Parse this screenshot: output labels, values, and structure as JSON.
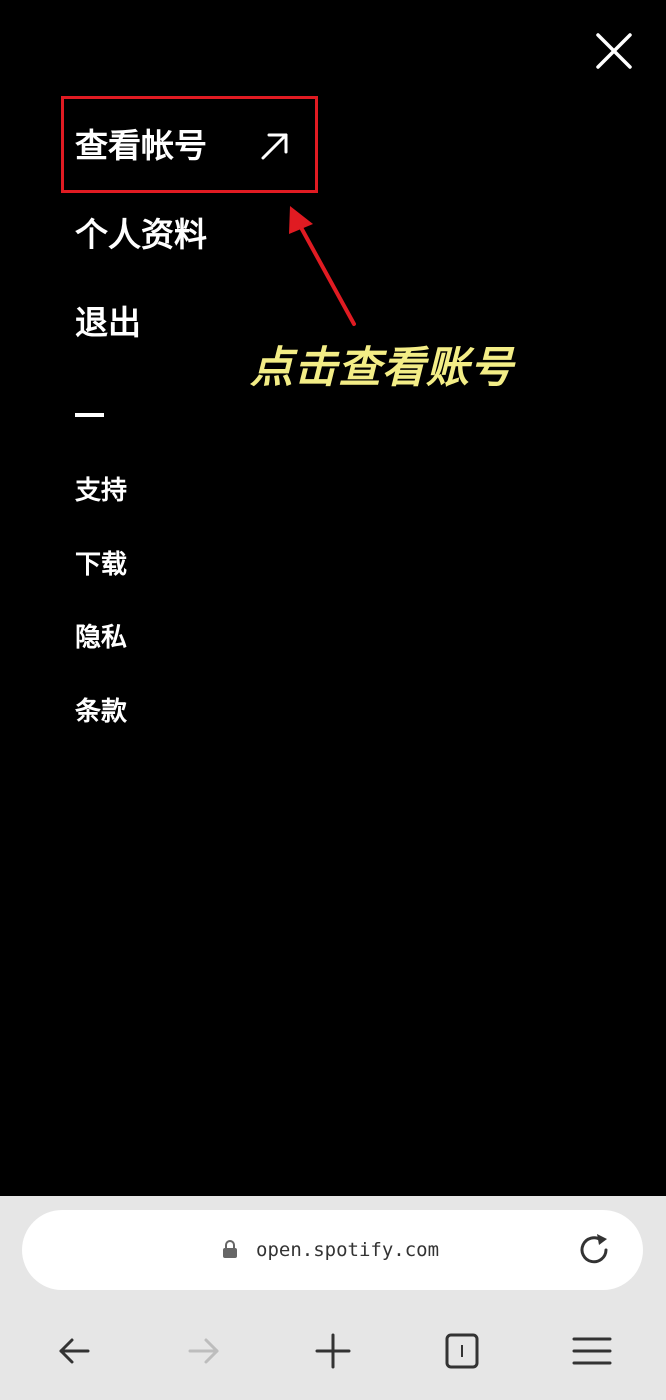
{
  "menu": {
    "view_account": "查看帐号",
    "profile": "个人资料",
    "logout": "退出",
    "support": "支持",
    "download": "下载",
    "privacy": "隐私",
    "terms": "条款"
  },
  "annotation": {
    "text": "点击查看账号",
    "color": "#f3ed86",
    "box_color": "#e01b22"
  },
  "browser": {
    "url": "open.spotify.com",
    "icons": [
      "lock-icon",
      "reload-icon",
      "back-icon",
      "forward-icon",
      "new-tab-icon",
      "tabs-icon",
      "menu-icon"
    ]
  },
  "icons": {
    "close": "close-icon",
    "external": "external-link-icon"
  }
}
